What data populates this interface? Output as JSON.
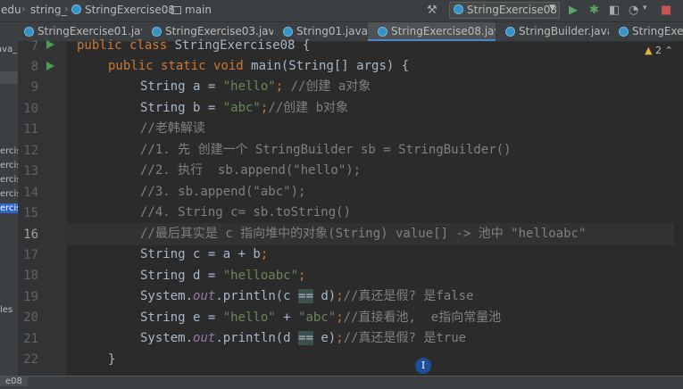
{
  "breadcrumb": {
    "project": "edu",
    "package": "string_",
    "class": "StringExercise08",
    "method": "main"
  },
  "run_config": "StringExercise08",
  "tabs": [
    {
      "label": "StringExercise01.java",
      "active": false
    },
    {
      "label": "StringExercise03.java",
      "active": false
    },
    {
      "label": "String01.java",
      "active": false
    },
    {
      "label": "StringExercise08.java",
      "active": true
    },
    {
      "label": "StringBuilder.java",
      "active": false
    },
    {
      "label": "StringExercis",
      "active": false
    }
  ],
  "project_panel": {
    "items": [
      "ava_",
      "ercis",
      "ercis",
      "ercis",
      "ercis",
      "ercis",
      "les"
    ]
  },
  "inspections": {
    "warnings": "2"
  },
  "editor": {
    "line_numbers": [
      "7",
      "8",
      "9",
      "10",
      "11",
      "12",
      "13",
      "14",
      "15",
      "16",
      "17",
      "18",
      "19",
      "20",
      "21",
      "22"
    ],
    "current_line": "16",
    "code": {
      "l7": {
        "kw": "public class ",
        "name": "StringExercise08 {"
      },
      "l8": {
        "kw": "public static void ",
        "rest": "main(String[] args) {"
      },
      "l9": {
        "pre": "String a = ",
        "str": "\"hello\"",
        "mid": "; ",
        "cm": "//创建 a对象"
      },
      "l10": {
        "pre": "String b = ",
        "str": "\"abc\"",
        "mid": ";",
        "cm": "//创建 b对象"
      },
      "l11": {
        "cm": "//老韩解读"
      },
      "l12": {
        "cm": "//1. 先 创建一个 StringBuilder sb = StringBuilder()"
      },
      "l13": {
        "cm": "//2. 执行  sb.append(\"hello\");"
      },
      "l14": {
        "cm": "//3. sb.append(\"abc\");"
      },
      "l15": {
        "cm": "//4. String c= sb.toString()"
      },
      "l16": {
        "cm": "//最后其实是 c 指向堆中的对象(String) value[] -> 池中 \"helloabc\""
      },
      "l17": {
        "pre": "String c = a + b",
        "mid": ";"
      },
      "l18": {
        "pre": "String d = ",
        "str": "\"helloabc\"",
        "mid": ";"
      },
      "l19": {
        "sys": "System.",
        "fld": "out",
        "call": ".println(c ",
        "op": "==",
        "args": " d)",
        "semi": ";",
        "cm": "//真还是假? 是false"
      },
      "l20": {
        "pre": "String e = ",
        "str1": "\"hello\"",
        "plus": " + ",
        "str2": "\"abc\"",
        "semi": ";",
        "cm": "//直接看池,  e指向常量池"
      },
      "l21": {
        "sys": "System.",
        "fld": "out",
        "call": ".println(d ",
        "op": "==",
        "args": " e)",
        "semi": ";",
        "cm": "//真还是假? 是true"
      },
      "l22": {
        "rest": "}"
      }
    }
  },
  "status": {
    "label": "e08"
  },
  "cursor": {
    "glyph": "I"
  }
}
